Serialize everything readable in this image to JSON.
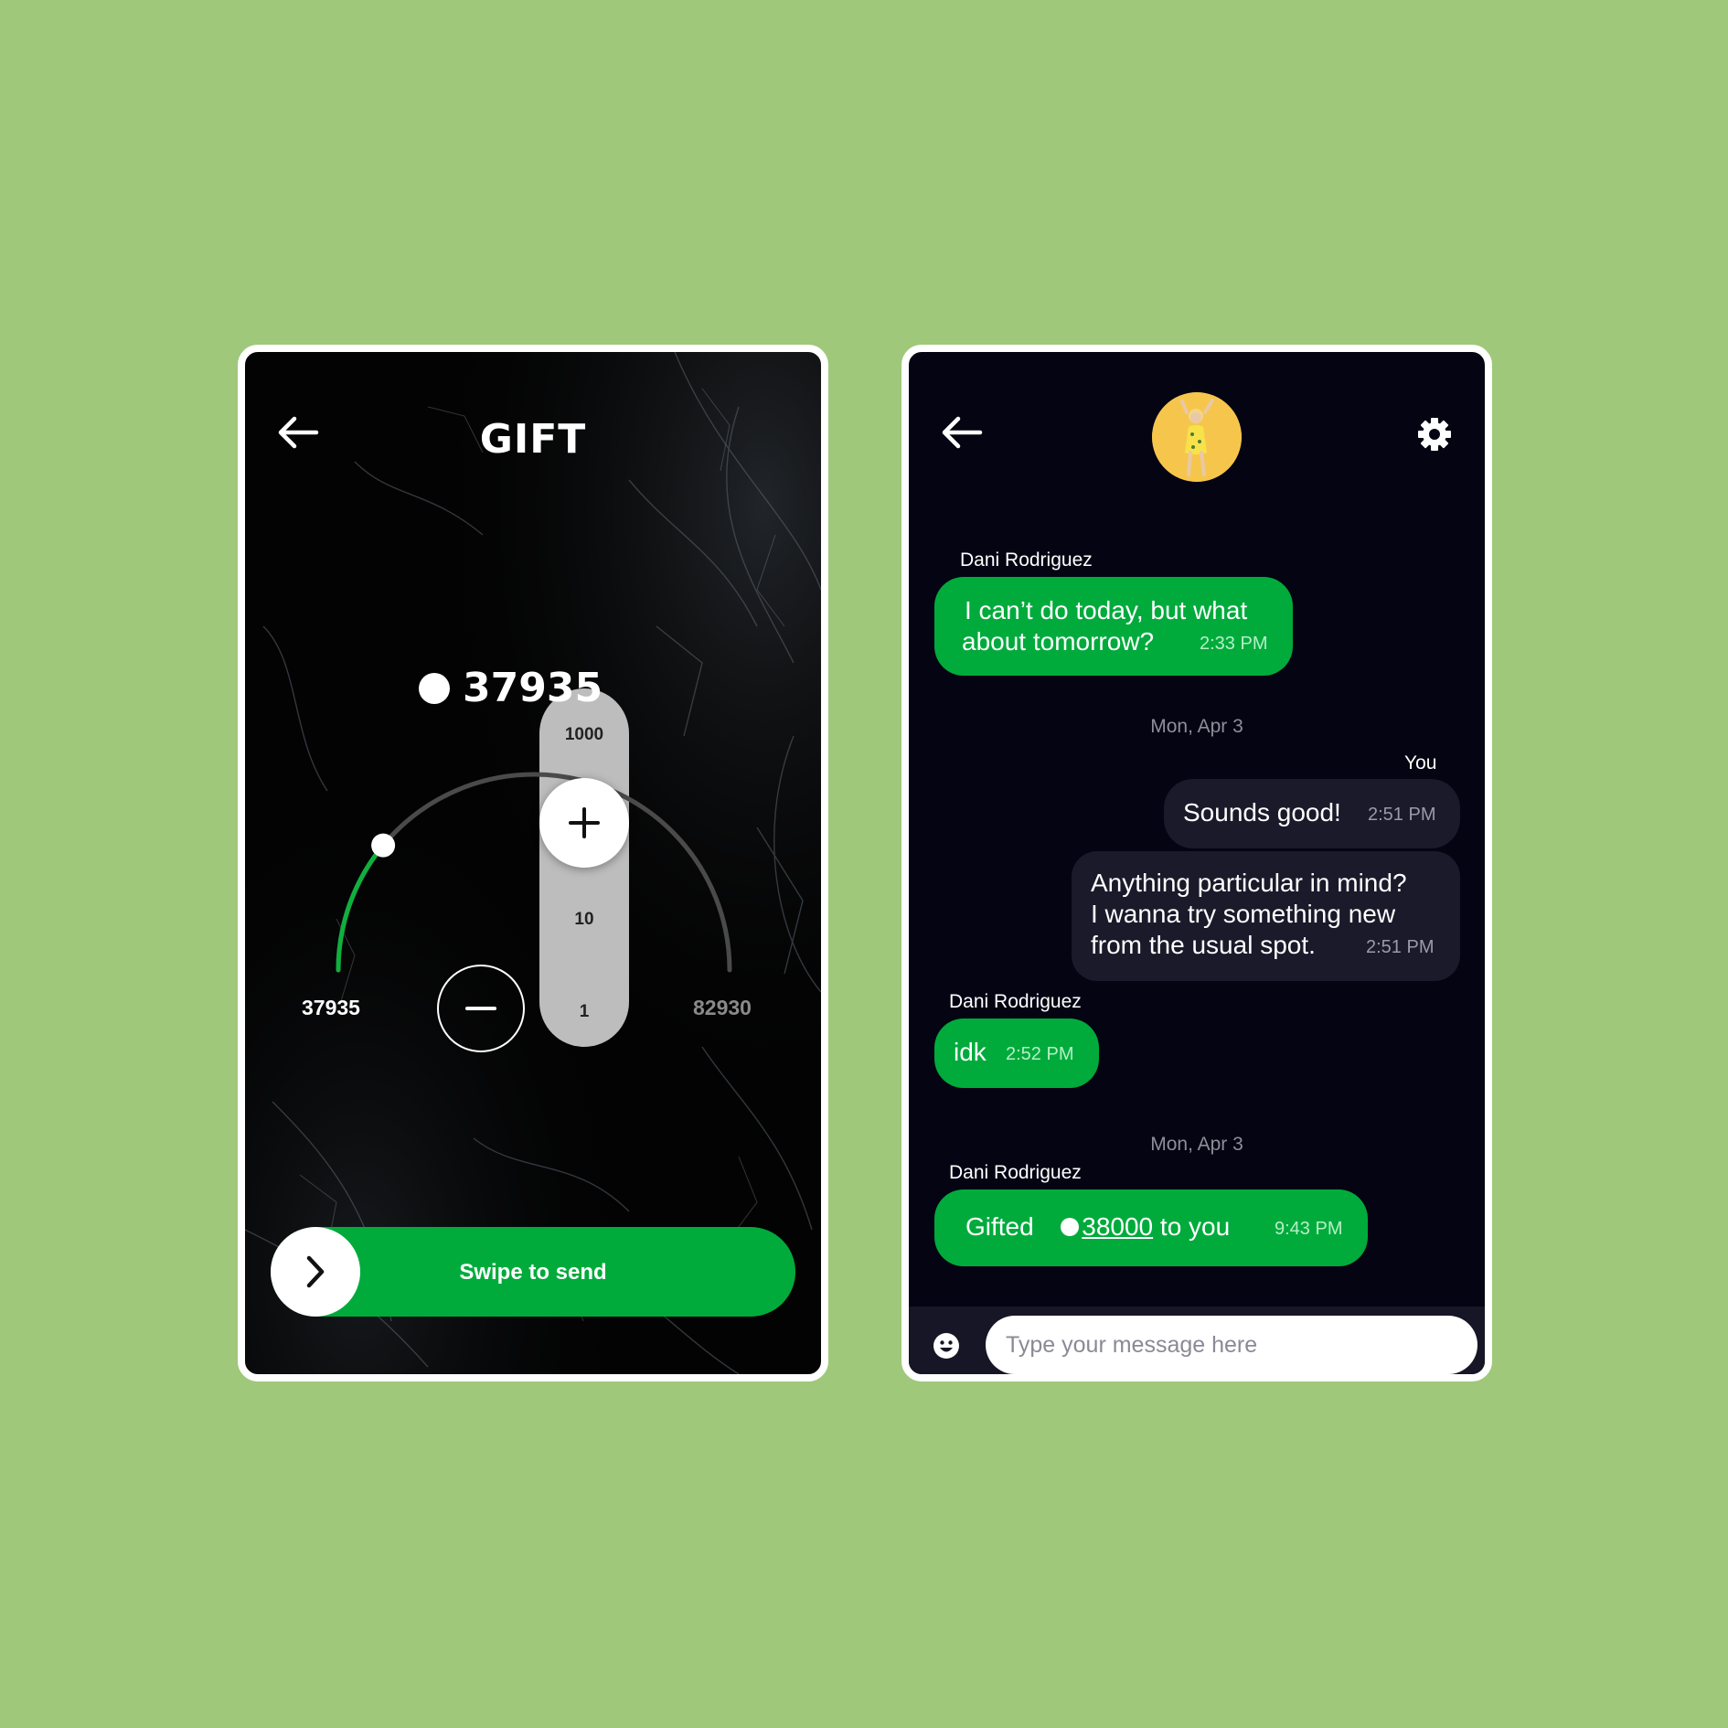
{
  "gift_screen": {
    "title": "GIFT",
    "balance": "37935",
    "steps": [
      "1000",
      "10",
      "1"
    ],
    "range_min": "37935",
    "range_max": "82930",
    "slider_progress": 0.22,
    "swipe_label": "Swipe to send",
    "icons": [
      "back-arrow-icon",
      "coin-icon",
      "plus-icon",
      "minus-icon",
      "chevron-right-icon"
    ]
  },
  "chat_screen": {
    "icons": [
      "back-arrow-icon",
      "avatar",
      "gear-icon",
      "emoji-icon"
    ],
    "messages": [
      {
        "sender": "Dani Rodriguez",
        "text_line1": "I can’t do today, but what",
        "text_line2": "about tomorrow?",
        "time": "2:33 PM"
      },
      {
        "date": "Mon, Apr 3"
      },
      {
        "sender": "You",
        "text": "Sounds good!",
        "time": "2:51 PM"
      },
      {
        "text_line1": "Anything particular in mind?",
        "text_line2": "I wanna try something new",
        "text_line3": "from the usual spot.",
        "time": "2:51 PM"
      },
      {
        "sender": "Dani Rodriguez",
        "text": "idk",
        "time": "2:52 PM"
      },
      {
        "date": "Mon, Apr 3"
      },
      {
        "sender": "Dani Rodriguez",
        "prefix": "Gifted",
        "amount": "38000",
        "suffix": "to you",
        "time": "9:43 PM"
      }
    ],
    "composer_placeholder": "Type your message here"
  },
  "colors": {
    "background": "#9fc87b",
    "accent_green": "#00ab3c",
    "chat_bg": "#050413",
    "outgoing_bubble": "#1a1a2b"
  }
}
